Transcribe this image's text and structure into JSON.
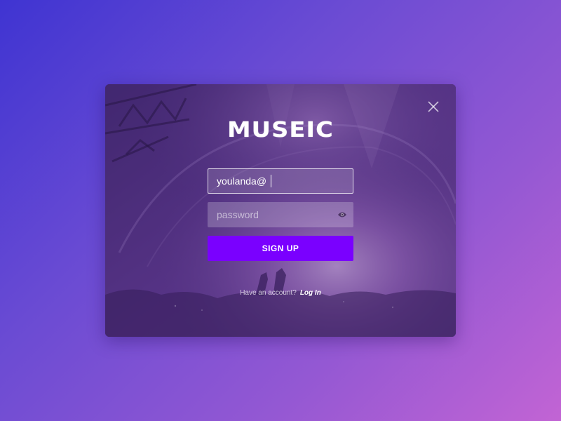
{
  "brand": {
    "logo_text": "MUSEIC"
  },
  "form": {
    "email": {
      "value": "youlanda@"
    },
    "password": {
      "placeholder": "password"
    },
    "signup_label": "SIGN UP"
  },
  "footer": {
    "question": "Have an account?",
    "login_label": "Log In"
  },
  "icons": {
    "close": "close-icon",
    "eye": "eye-icon"
  },
  "colors": {
    "primary_button": "#7a00ff",
    "background_start": "#3f34d2",
    "background_end": "#c264d4"
  }
}
